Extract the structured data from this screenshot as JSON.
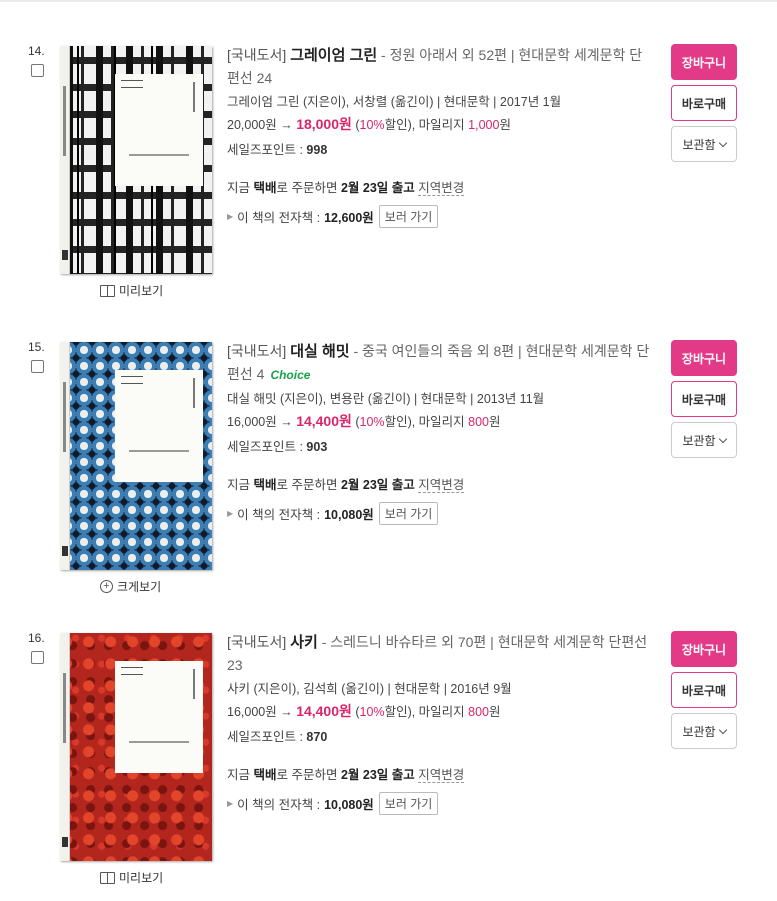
{
  "items": [
    {
      "num": "14.",
      "tag": "[국내도서]",
      "title": "그레이엄 그린",
      "series": " - 정원 아래서 외 52편  |  현대문학 세계문학 단편선 24",
      "choice": "",
      "meta": "그레이엄 그린 (지은이), 서창렬 (옮긴이) | 현대문학 | 2017년 1월",
      "list_price": "20,000원 → ",
      "sale_price": "18,000원",
      "discount_pre": " (",
      "discount_pct": "10%",
      "discount_post": "할인), 마일리지 ",
      "mileage": "1,000",
      "mileage_unit": "원",
      "points_label": "세일즈포인트 : ",
      "points": "998",
      "delivery_pre": "지금 ",
      "delivery_bold1": "택배",
      "delivery_mid": "로 주문하면 ",
      "delivery_bold2": "2월 23일 출고",
      "delivery_region": "지역변경",
      "ebook_label": "이 책의 전자책 :",
      "ebook_price": "12,600원",
      "ebook_button": "보러 가기",
      "preview_label": "미리보기",
      "preview_icon": "book-open-icon",
      "cover_style": "bw"
    },
    {
      "num": "15.",
      "tag": "[국내도서]",
      "title": "대실 해밋",
      "series": " - 중국 여인들의 죽음 외 8편  |  현대문학 세계문학 단편선 4",
      "choice": "Choice",
      "meta": "대실 해밋 (지은이), 변용란 (옮긴이) | 현대문학 | 2013년 11월",
      "list_price": "16,000원 → ",
      "sale_price": "14,400원",
      "discount_pre": " (",
      "discount_pct": "10%",
      "discount_post": "할인), 마일리지 ",
      "mileage": "800",
      "mileage_unit": "원",
      "points_label": "세일즈포인트 : ",
      "points": "903",
      "delivery_pre": "지금 ",
      "delivery_bold1": "택배",
      "delivery_mid": "로 주문하면 ",
      "delivery_bold2": "2월 23일 출고",
      "delivery_region": "지역변경",
      "ebook_label": "이 책의 전자책 :",
      "ebook_price": "10,080원",
      "ebook_button": "보러 가기",
      "preview_label": "크게보기",
      "preview_icon": "zoom-plus-icon",
      "cover_style": "blue"
    },
    {
      "num": "16.",
      "tag": "[국내도서]",
      "title": "사키",
      "series": " - 스레드니 바슈타르 외 70편  |  현대문학 세계문학 단편선 23",
      "choice": "",
      "meta": "사키 (지은이), 김석희 (옮긴이) | 현대문학 | 2016년 9월",
      "list_price": "16,000원 → ",
      "sale_price": "14,400원",
      "discount_pre": " (",
      "discount_pct": "10%",
      "discount_post": "할인), 마일리지 ",
      "mileage": "800",
      "mileage_unit": "원",
      "points_label": "세일즈포인트 : ",
      "points": "870",
      "delivery_pre": "지금 ",
      "delivery_bold1": "택배",
      "delivery_mid": "로 주문하면 ",
      "delivery_bold2": "2월 23일 출고",
      "delivery_region": "지역변경",
      "ebook_label": "이 책의 전자책 :",
      "ebook_price": "10,080원",
      "ebook_button": "보러 가기",
      "preview_label": "미리보기",
      "preview_icon": "book-open-icon",
      "cover_style": "red"
    }
  ],
  "buttons": {
    "cart": "장바구니",
    "buy": "바로구매",
    "keep": "보관함"
  },
  "colors": {
    "accent_pink": "#e33a87",
    "sale_pink": "#d9256b",
    "choice_green": "#1aa34a"
  }
}
